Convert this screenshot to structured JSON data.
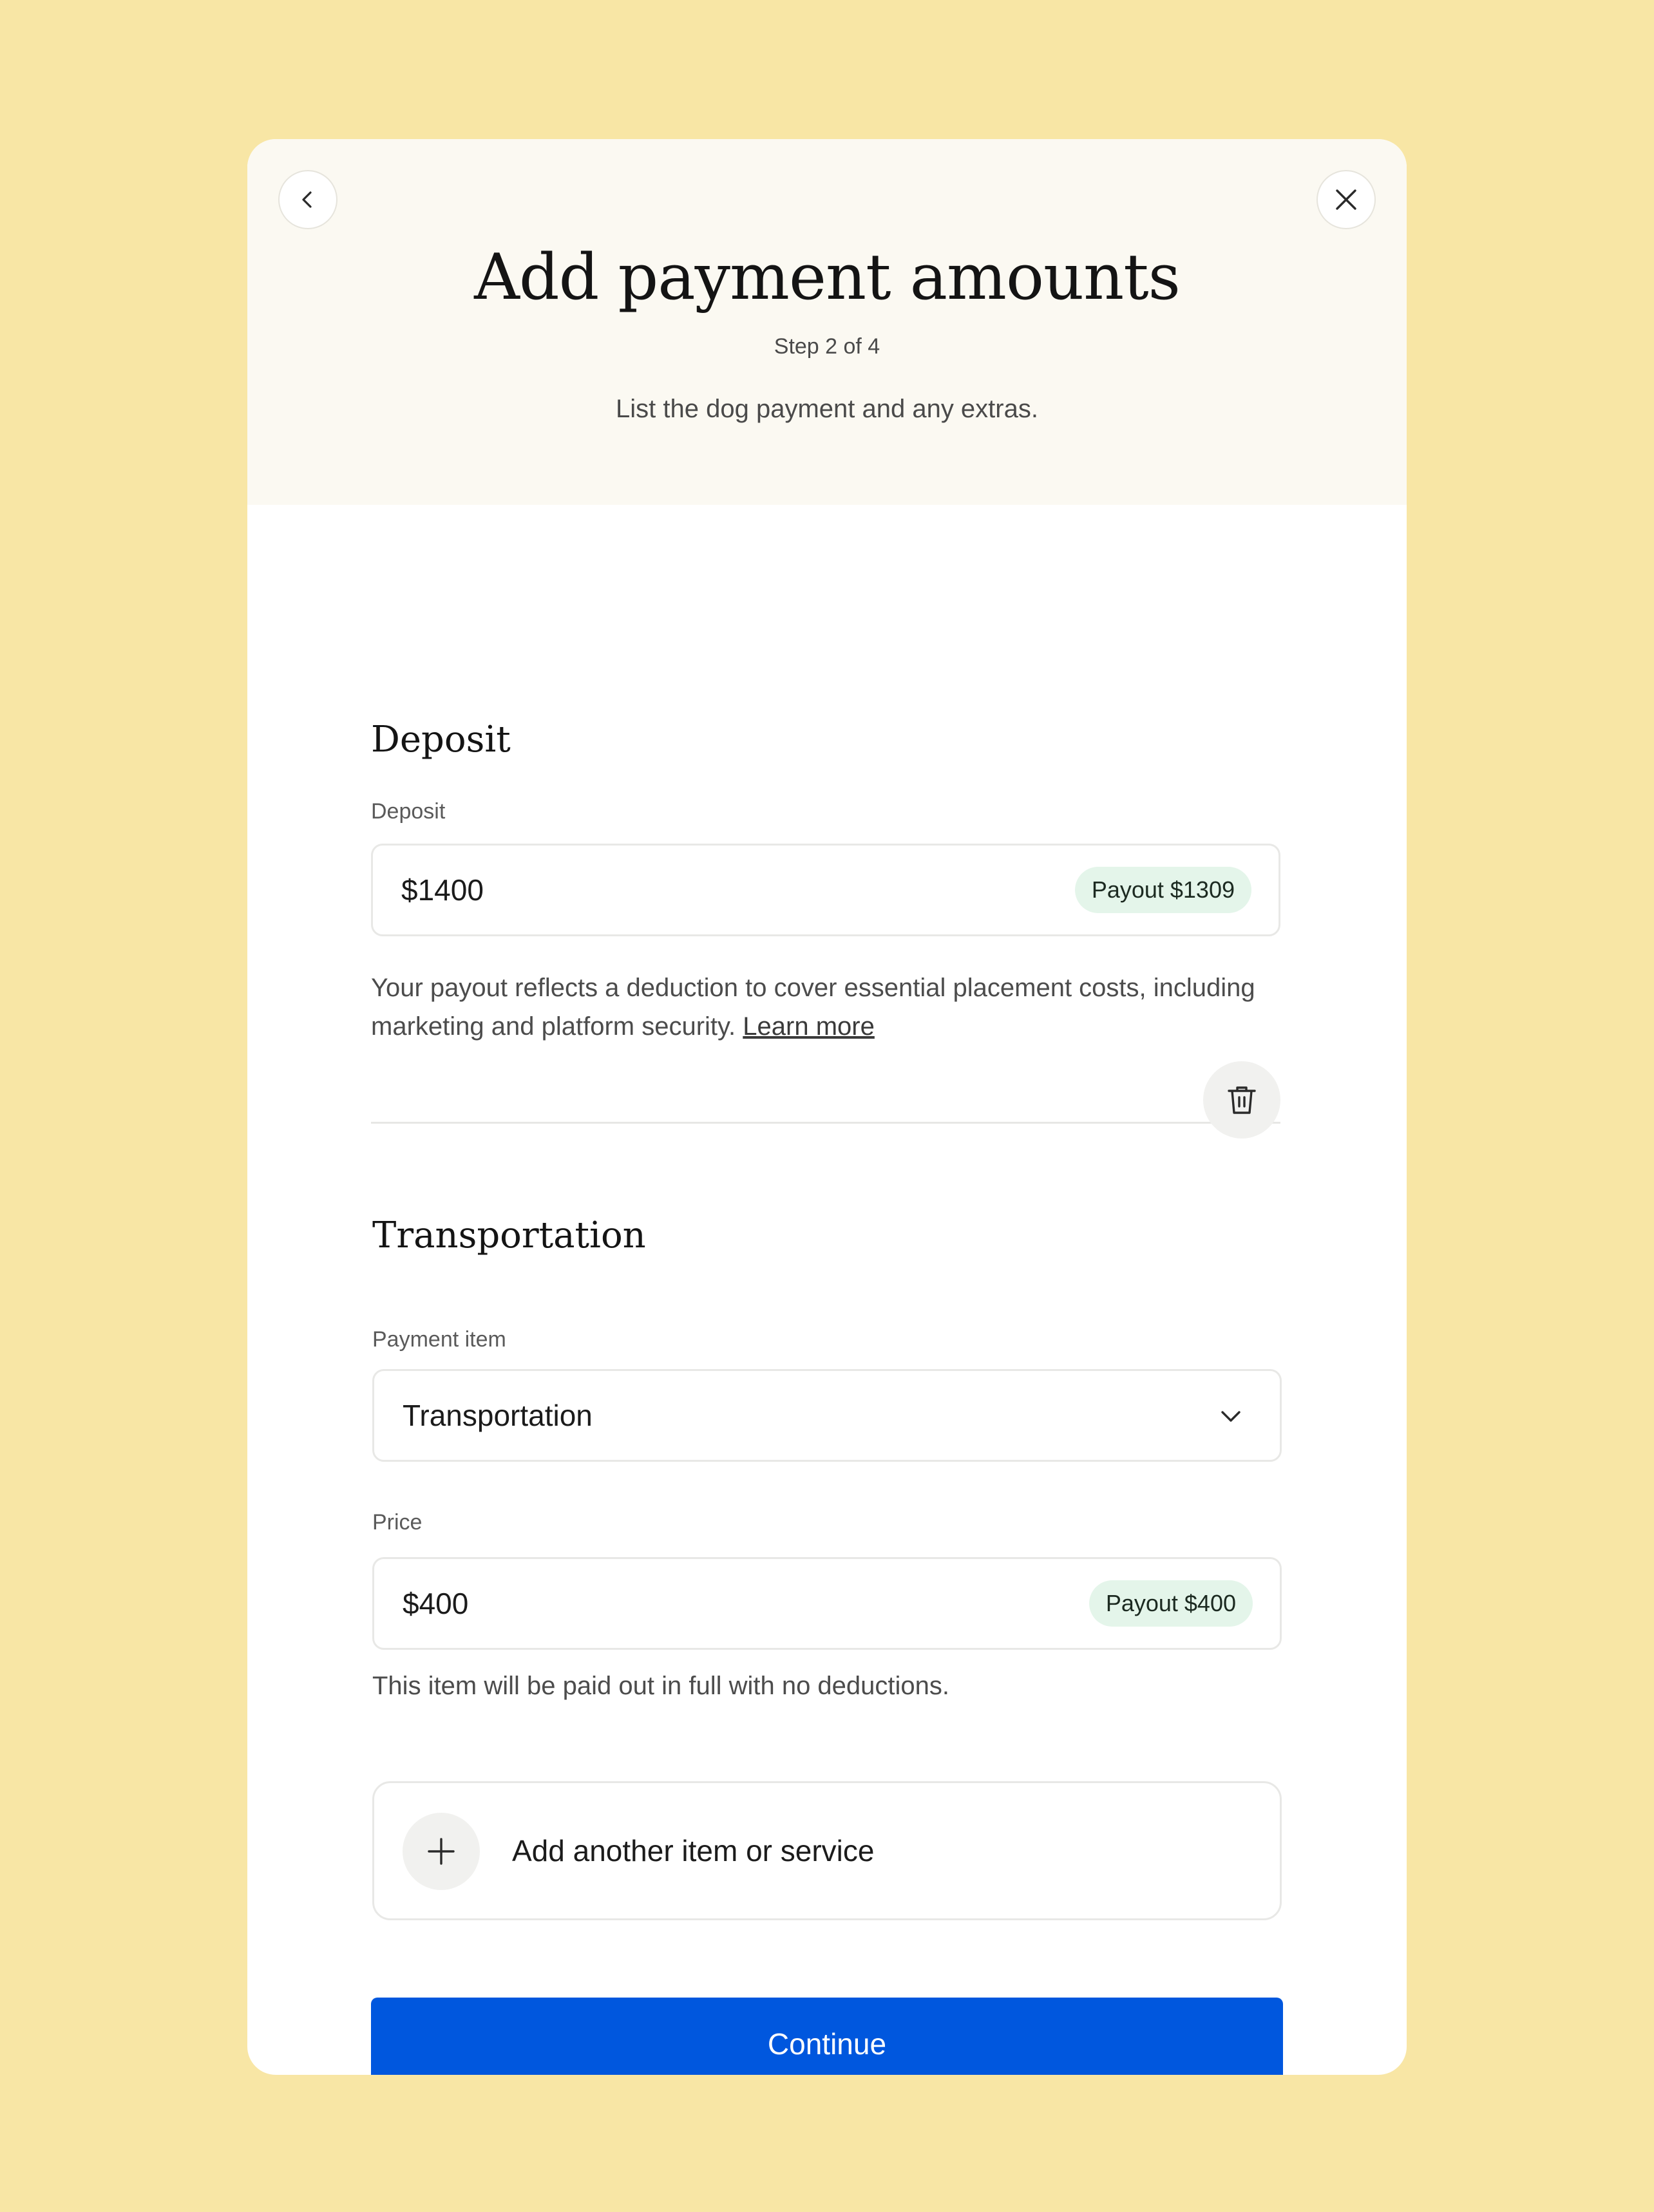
{
  "header": {
    "title": "Add payment amounts",
    "step": "Step 2 of 4",
    "subtitle": "List the dog payment and any extras."
  },
  "icons": {
    "back": "chevron-left-icon",
    "close": "close-icon",
    "trash": "trash-icon",
    "chevron": "chevron-down-icon",
    "add": "plus-icon"
  },
  "deposit": {
    "section_title": "Deposit",
    "label": "Deposit",
    "value": "$1400",
    "payout": "Payout $1309",
    "help_text": "Your payout reflects a deduction to cover essential placement costs, including marketing and platform security.",
    "learn_more": "Learn more"
  },
  "transportation": {
    "section_title": "Transportation",
    "item_label": "Payment item",
    "item_value": "Transportation",
    "price_label": "Price",
    "price_value": "$400",
    "payout": "Payout $400",
    "help_text": "This item will be paid out in full with no deductions."
  },
  "add_item": {
    "label": "Add another item or service"
  },
  "continue_label": "Continue",
  "colors": {
    "page_background": "#f8e6a5",
    "header_background": "#fbf9f2",
    "payout_badge": "#e4f5ea",
    "primary_button": "#0057de"
  }
}
